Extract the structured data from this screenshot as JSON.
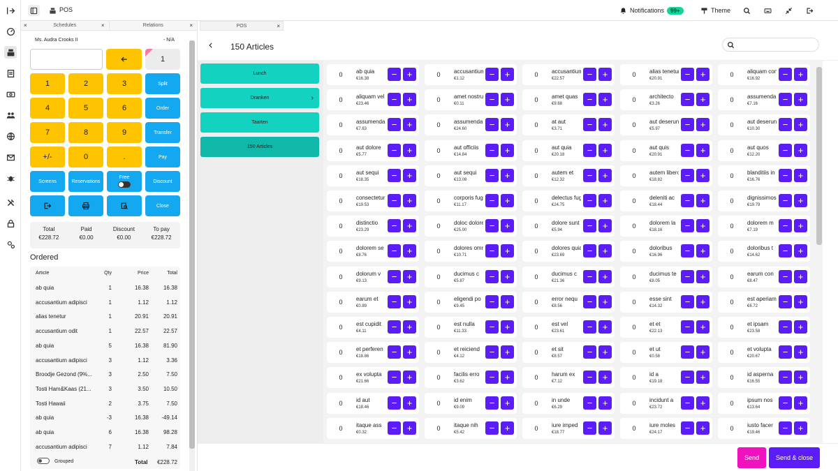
{
  "topbar": {
    "title": "POS",
    "notifications_label": "Notifications",
    "notifications_count": "99+",
    "theme_label": "Theme"
  },
  "left": {
    "tabs": [
      "Schedules",
      "Relations"
    ],
    "client_name": "Ms. Audra Crooks II",
    "client_extra": "- N/A",
    "qty_key": "1",
    "keys": {
      "k1": "1",
      "k2": "2",
      "k3": "3",
      "k4": "4",
      "k5": "5",
      "k6": "6",
      "k7": "7",
      "k8": "8",
      "k9": "9",
      "plusminus": "+/-",
      "k0": "0",
      "dot": "."
    },
    "actions": {
      "split": "Split",
      "order": "Order",
      "transfer": "Transfer",
      "pay": "Pay",
      "screens": "Screens",
      "reservations": "Reservations",
      "free": "Free",
      "discount": "Discount",
      "close": "Close"
    },
    "totals": [
      {
        "label": "Total",
        "value": "€228.72"
      },
      {
        "label": "Paid",
        "value": "€0.00"
      },
      {
        "label": "Discount",
        "value": "€0.00"
      },
      {
        "label": "To pay",
        "value": "€228.72"
      }
    ],
    "ordered_title": "Ordered",
    "order_headers": {
      "article": "Article",
      "qty": "Qty",
      "price": "Price",
      "total": "Total"
    },
    "order_rows": [
      {
        "article": "ab quia",
        "qty": "1",
        "price": "16.38",
        "total": "16.38"
      },
      {
        "article": "accusantium adipisci",
        "qty": "1",
        "price": "1.12",
        "total": "1.12"
      },
      {
        "article": "alias tenetur",
        "qty": "1",
        "price": "20.91",
        "total": "20.91"
      },
      {
        "article": "accusantium odit",
        "qty": "1",
        "price": "22.57",
        "total": "22.57"
      },
      {
        "article": "ab quia",
        "qty": "5",
        "price": "16.38",
        "total": "81.90"
      },
      {
        "article": "accusantium adipisci",
        "qty": "3",
        "price": "1.12",
        "total": "3.36"
      },
      {
        "article": "Broodje Gezond (9%...",
        "qty": "3",
        "price": "2.50",
        "total": "7.50"
      },
      {
        "article": "Tosti Ham&Kaas (21...",
        "qty": "3",
        "price": "3.50",
        "total": "10.50"
      },
      {
        "article": "Tosti Hawaii",
        "qty": "2",
        "price": "3.75",
        "total": "7.50"
      },
      {
        "article": "ab quia",
        "qty": "-3",
        "price": "16.38",
        "total": "-49.14"
      },
      {
        "article": "ab quia",
        "qty": "6",
        "price": "16.38",
        "total": "98.28"
      },
      {
        "article": "accusantium adipisci",
        "qty": "7",
        "price": "1.12",
        "total": "7.84"
      }
    ],
    "grouped_label": "Grouped",
    "grand_total_label": "Total",
    "grand_total_value": "€228.72"
  },
  "main": {
    "tab_label": "POS",
    "title": "150 Articles",
    "categories": [
      {
        "label": "Lunch",
        "has_children": false,
        "selected": false
      },
      {
        "label": "Dranken",
        "has_children": true,
        "selected": false
      },
      {
        "label": "Taarten",
        "has_children": false,
        "selected": false
      },
      {
        "label": "150 Articles",
        "has_children": false,
        "selected": true
      }
    ],
    "articles": [
      {
        "name": "ab quia",
        "price": "€16.38",
        "qty": "0"
      },
      {
        "name": "accusantium adipisci",
        "price": "€1.12",
        "qty": "0"
      },
      {
        "name": "accusantium odit",
        "price": "€22.57",
        "qty": "0"
      },
      {
        "name": "alias tenetur",
        "price": "€20.91",
        "qty": "0"
      },
      {
        "name": "aliquam consequatur",
        "price": "€16.92",
        "qty": "0"
      },
      {
        "name": "aliquam vel",
        "price": "€23.46",
        "qty": "0"
      },
      {
        "name": "amet nostrum",
        "price": "€0.11",
        "qty": "0"
      },
      {
        "name": "amet quas",
        "price": "€9.68",
        "qty": "0"
      },
      {
        "name": "architecto",
        "price": "€3.26",
        "qty": "0"
      },
      {
        "name": "assumenda",
        "price": "€7.16",
        "qty": "0"
      },
      {
        "name": "assumenda",
        "price": "€7.63",
        "qty": "0"
      },
      {
        "name": "assumenda",
        "price": "€24.60",
        "qty": "0"
      },
      {
        "name": "at aut",
        "price": "€3.71",
        "qty": "0"
      },
      {
        "name": "aut deserunt",
        "price": "€5.97",
        "qty": "0"
      },
      {
        "name": "aut deserunt",
        "price": "€10.30",
        "qty": "0"
      },
      {
        "name": "aut dolore",
        "price": "€5.77",
        "qty": "0"
      },
      {
        "name": "aut officiis",
        "price": "€14.84",
        "qty": "0"
      },
      {
        "name": "aut quia",
        "price": "€20.18",
        "qty": "0"
      },
      {
        "name": "aut quis",
        "price": "€20.91",
        "qty": "0"
      },
      {
        "name": "aut quos",
        "price": "€12.20",
        "qty": "0"
      },
      {
        "name": "aut sequi",
        "price": "€18.35",
        "qty": "0"
      },
      {
        "name": "aut sequi",
        "price": "€13.08",
        "qty": "0"
      },
      {
        "name": "autem et",
        "price": "€12.32",
        "qty": "0"
      },
      {
        "name": "autem libero",
        "price": "€18.82",
        "qty": "0"
      },
      {
        "name": "blanditiis in",
        "price": "€16.76",
        "qty": "0"
      },
      {
        "name": "consectetur",
        "price": "€19.53",
        "qty": "0"
      },
      {
        "name": "corporis fugit",
        "price": "€11.17",
        "qty": "0"
      },
      {
        "name": "delectus fuga",
        "price": "€24.75",
        "qty": "0"
      },
      {
        "name": "deleniti ac",
        "price": "€18.44",
        "qty": "0"
      },
      {
        "name": "dignissimos",
        "price": "€19.79",
        "qty": "0"
      },
      {
        "name": "distinctio",
        "price": "€23.29",
        "qty": "0"
      },
      {
        "name": "doloc dolores",
        "price": "€25.00",
        "qty": "0"
      },
      {
        "name": "dolore sunt",
        "price": "€5.94",
        "qty": "0"
      },
      {
        "name": "dolorem la",
        "price": "€18.16",
        "qty": "0"
      },
      {
        "name": "dolorem m",
        "price": "€7.19",
        "qty": "0"
      },
      {
        "name": "dolorem se",
        "price": "€8.76",
        "qty": "0"
      },
      {
        "name": "dolores omnis",
        "price": "€10.71",
        "qty": "0"
      },
      {
        "name": "dolores quia",
        "price": "€23.69",
        "qty": "0"
      },
      {
        "name": "doloribus",
        "price": "€16.96",
        "qty": "0"
      },
      {
        "name": "doloribus t",
        "price": "€14.62",
        "qty": "0"
      },
      {
        "name": "dolorum v",
        "price": "€9.13",
        "qty": "0"
      },
      {
        "name": "ducimus c",
        "price": "€5.87",
        "qty": "0"
      },
      {
        "name": "ducimus c",
        "price": "€21.36",
        "qty": "0"
      },
      {
        "name": "ducimus te",
        "price": "€8.05",
        "qty": "0"
      },
      {
        "name": "earum con",
        "price": "€8.47",
        "qty": "0"
      },
      {
        "name": "earum et",
        "price": "€0.89",
        "qty": "0"
      },
      {
        "name": "eligendi po",
        "price": "€9.45",
        "qty": "0"
      },
      {
        "name": "error nequ",
        "price": "€8.56",
        "qty": "0"
      },
      {
        "name": "esse sint",
        "price": "€14.32",
        "qty": "0"
      },
      {
        "name": "est aperiam",
        "price": "€6.72",
        "qty": "0"
      },
      {
        "name": "est cupidit",
        "price": "€4.11",
        "qty": "0"
      },
      {
        "name": "est nulla",
        "price": "€11.33",
        "qty": "0"
      },
      {
        "name": "est vel",
        "price": "€23.61",
        "qty": "0"
      },
      {
        "name": "et et",
        "price": "€22.13",
        "qty": "0"
      },
      {
        "name": "et ipsam",
        "price": "€23.58",
        "qty": "0"
      },
      {
        "name": "et perferen",
        "price": "€18.86",
        "qty": "0"
      },
      {
        "name": "et reiciend",
        "price": "€4.12",
        "qty": "0"
      },
      {
        "name": "et sit",
        "price": "€8.57",
        "qty": "0"
      },
      {
        "name": "et ut",
        "price": "€0.58",
        "qty": "0"
      },
      {
        "name": "et volupta",
        "price": "€20.67",
        "qty": "0"
      },
      {
        "name": "ex volupta",
        "price": "€21.66",
        "qty": "0"
      },
      {
        "name": "facilis erro",
        "price": "€3.62",
        "qty": "0"
      },
      {
        "name": "harum ex",
        "price": "€7.12",
        "qty": "0"
      },
      {
        "name": "id a",
        "price": "€19.18",
        "qty": "0"
      },
      {
        "name": "id asperna",
        "price": "€16.55",
        "qty": "0"
      },
      {
        "name": "id aut",
        "price": "€18.46",
        "qty": "0"
      },
      {
        "name": "id enim",
        "price": "€9.09",
        "qty": "0"
      },
      {
        "name": "in unde",
        "price": "€6.29",
        "qty": "0"
      },
      {
        "name": "incidunt a",
        "price": "€23.72",
        "qty": "0"
      },
      {
        "name": "ipsum nos",
        "price": "€13.64",
        "qty": "0"
      },
      {
        "name": "itaque ass",
        "price": "€0.32",
        "qty": "0"
      },
      {
        "name": "itaque nih",
        "price": "€5.42",
        "qty": "0"
      },
      {
        "name": "iure imped",
        "price": "€18.77",
        "qty": "0"
      },
      {
        "name": "iure moles",
        "price": "€24.17",
        "qty": "0"
      },
      {
        "name": "iusto facer",
        "price": "€19.46",
        "qty": "0"
      }
    ],
    "minus_label": "−",
    "plus_label": "+",
    "send_label": "Send",
    "send_close_label": "Send & close"
  },
  "colors": {
    "accent": "#5b1cf7",
    "numpad": "#ffc400",
    "action": "#13a8f0",
    "category": "#13d2c0",
    "send": "#f012be",
    "send_close": "#5b1cf7",
    "badge": "#16d39a"
  }
}
